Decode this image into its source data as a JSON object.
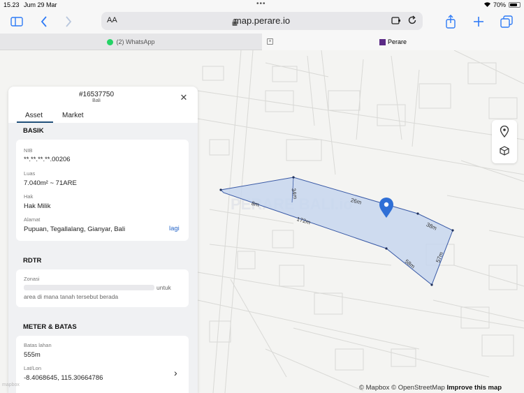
{
  "status": {
    "time": "15.23",
    "date": "Jum 29 Mar",
    "dots": "•••",
    "battery": "70%"
  },
  "browser": {
    "aa_label": "AA",
    "url": "map.perare.io",
    "tabs": [
      {
        "label": "(2) WhatsApp"
      },
      {
        "label": "Perare"
      }
    ]
  },
  "panel": {
    "id": "#16537750",
    "subtitle": "Bali",
    "tabs": [
      {
        "label": "Asset"
      },
      {
        "label": "Market"
      }
    ],
    "basik": {
      "title": "BASIK",
      "nib_label": "NIB",
      "nib_value": "**.**.**.**.00206",
      "luas_label": "Luas",
      "luas_value": "7.040m² ~ 71ARE",
      "hak_label": "Hak",
      "hak_value": "Hak Milik",
      "alamat_label": "Alamat",
      "alamat_value": "Pupuan, Tegallalang, Gianyar, Bali",
      "more_link": "lagi"
    },
    "rdtr": {
      "title": "RDTR",
      "zonasi_label": "Zonasi",
      "zonasi_suffix": "untuk",
      "zonasi_text": "area di mana tanah tersebut berada"
    },
    "meter": {
      "title": "METER & BATAS",
      "batas_label": "Batas lahan",
      "batas_value": "555m",
      "latlon_label": "Lat/Lon",
      "latlon_value": "-8.4068645, 115.30664786"
    }
  },
  "map": {
    "watermark": "PERARE BALI.io",
    "dimensions": [
      "34m",
      "26m",
      "38m",
      "57m",
      "58m",
      "172m",
      "8m"
    ],
    "polygon_fill": "#c7d6ef",
    "polygon_stroke": "#3a5aa6",
    "pin_color": "#2f6fd6"
  },
  "attribution": {
    "mapbox": "© Mapbox",
    "osm": "© OpenStreetMap",
    "improve": "Improve this map",
    "logo": "mapbox"
  }
}
